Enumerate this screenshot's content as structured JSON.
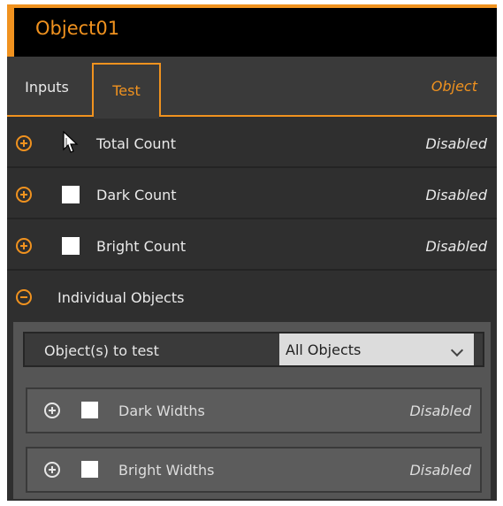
{
  "title": "Object01",
  "colors": {
    "accent": "#f0921f",
    "panel": "#2f2f2f",
    "subpanel": "#555555"
  },
  "tabs": [
    {
      "label": "Inputs",
      "active": false
    },
    {
      "label": "Test",
      "active": true
    }
  ],
  "tab_right_label": "Object",
  "rows": [
    {
      "label": "Total Count",
      "status": "Disabled",
      "expanded": false,
      "checked": false
    },
    {
      "label": "Dark Count",
      "status": "Disabled",
      "expanded": false,
      "checked": false
    },
    {
      "label": "Bright Count",
      "status": "Disabled",
      "expanded": false,
      "checked": false
    }
  ],
  "individual": {
    "label": "Individual Objects",
    "expanded": true,
    "select": {
      "label": "Object(s) to test",
      "value": "All Objects"
    },
    "sub_rows": [
      {
        "label": "Dark Widths",
        "status": "Disabled",
        "checked": false
      },
      {
        "label": "Bright Widths",
        "status": "Disabled",
        "checked": false
      }
    ]
  },
  "icons": {
    "expand": "plus-circle-icon",
    "collapse": "minus-circle-icon",
    "cursor": "mouse-cursor-icon"
  }
}
